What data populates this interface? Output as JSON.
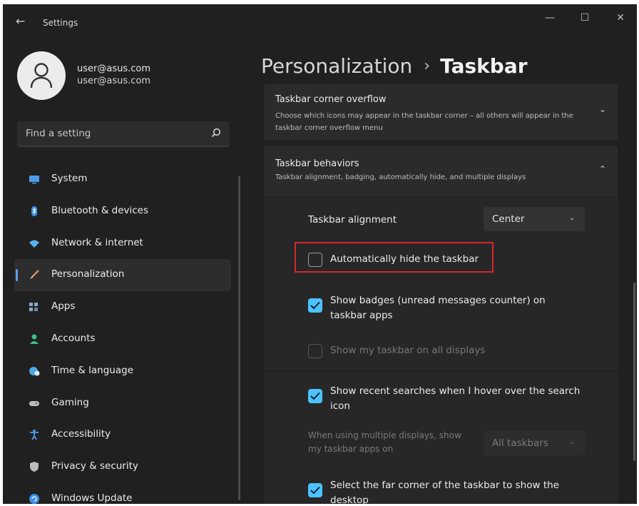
{
  "window": {
    "title": "Settings",
    "back_glyph": "←",
    "controls": {
      "minimize": "—",
      "maximize": "☐",
      "close": "✕"
    }
  },
  "user": {
    "name": "user@asus.com",
    "email": "user@asus.com",
    "avatar_icon": "person-icon"
  },
  "search": {
    "placeholder": "Find a setting",
    "icon": "search-icon"
  },
  "sidebar": {
    "items": [
      {
        "label": "System",
        "icon": "monitor-icon",
        "color": "#4a9de8"
      },
      {
        "label": "Bluetooth & devices",
        "icon": "bluetooth-icon",
        "color": "#3b8fe6"
      },
      {
        "label": "Network & internet",
        "icon": "wifi-icon",
        "color": "#5ab0f0"
      },
      {
        "label": "Personalization",
        "icon": "brush-icon",
        "color": "#e8a060",
        "active": true
      },
      {
        "label": "Apps",
        "icon": "apps-icon",
        "color": "#8aa8c8"
      },
      {
        "label": "Accounts",
        "icon": "account-icon",
        "color": "#3cc08a"
      },
      {
        "label": "Time & language",
        "icon": "globe-clock-icon",
        "color": "#4aa8e8"
      },
      {
        "label": "Gaming",
        "icon": "gamepad-icon",
        "color": "#bcbcbc"
      },
      {
        "label": "Accessibility",
        "icon": "accessibility-icon",
        "color": "#4aa0f0"
      },
      {
        "label": "Privacy & security",
        "icon": "shield-icon",
        "color": "#bcbcbc"
      },
      {
        "label": "Windows Update",
        "icon": "update-icon",
        "color": "#3b8fe6"
      }
    ]
  },
  "breadcrumb": {
    "parent": "Personalization",
    "separator": "›",
    "current": "Taskbar"
  },
  "sections": {
    "corner_overflow": {
      "title": "Taskbar corner overflow",
      "description": "Choose which icons may appear in the taskbar corner – all others will appear in the taskbar corner overflow menu",
      "chevron": "⌄"
    },
    "behaviors": {
      "title": "Taskbar behaviors",
      "description": "Taskbar alignment, badging, automatically hide, and multiple displays",
      "chevron": "⌃",
      "alignment": {
        "label": "Taskbar alignment",
        "value": "Center",
        "chevron": "⌄"
      },
      "auto_hide": {
        "label": "Automatically hide the taskbar",
        "checked": false
      },
      "badges": {
        "label": "Show badges (unread messages counter) on taskbar apps",
        "checked": true
      },
      "all_displays": {
        "label": "Show my taskbar on all displays",
        "checked": false,
        "disabled": true
      },
      "recent_searches": {
        "label": "Show recent searches when I hover over the search icon",
        "checked": true
      },
      "multi_display": {
        "label": "When using multiple displays, show my taskbar apps on",
        "value": "All taskbars",
        "chevron": "⌄",
        "disabled": true
      },
      "far_corner": {
        "label": "Select the far corner of the taskbar to show the desktop",
        "checked": true
      }
    }
  },
  "colors": {
    "accent": "#4cc2ff",
    "highlight_box": "#d9262c",
    "background": "#202020"
  }
}
